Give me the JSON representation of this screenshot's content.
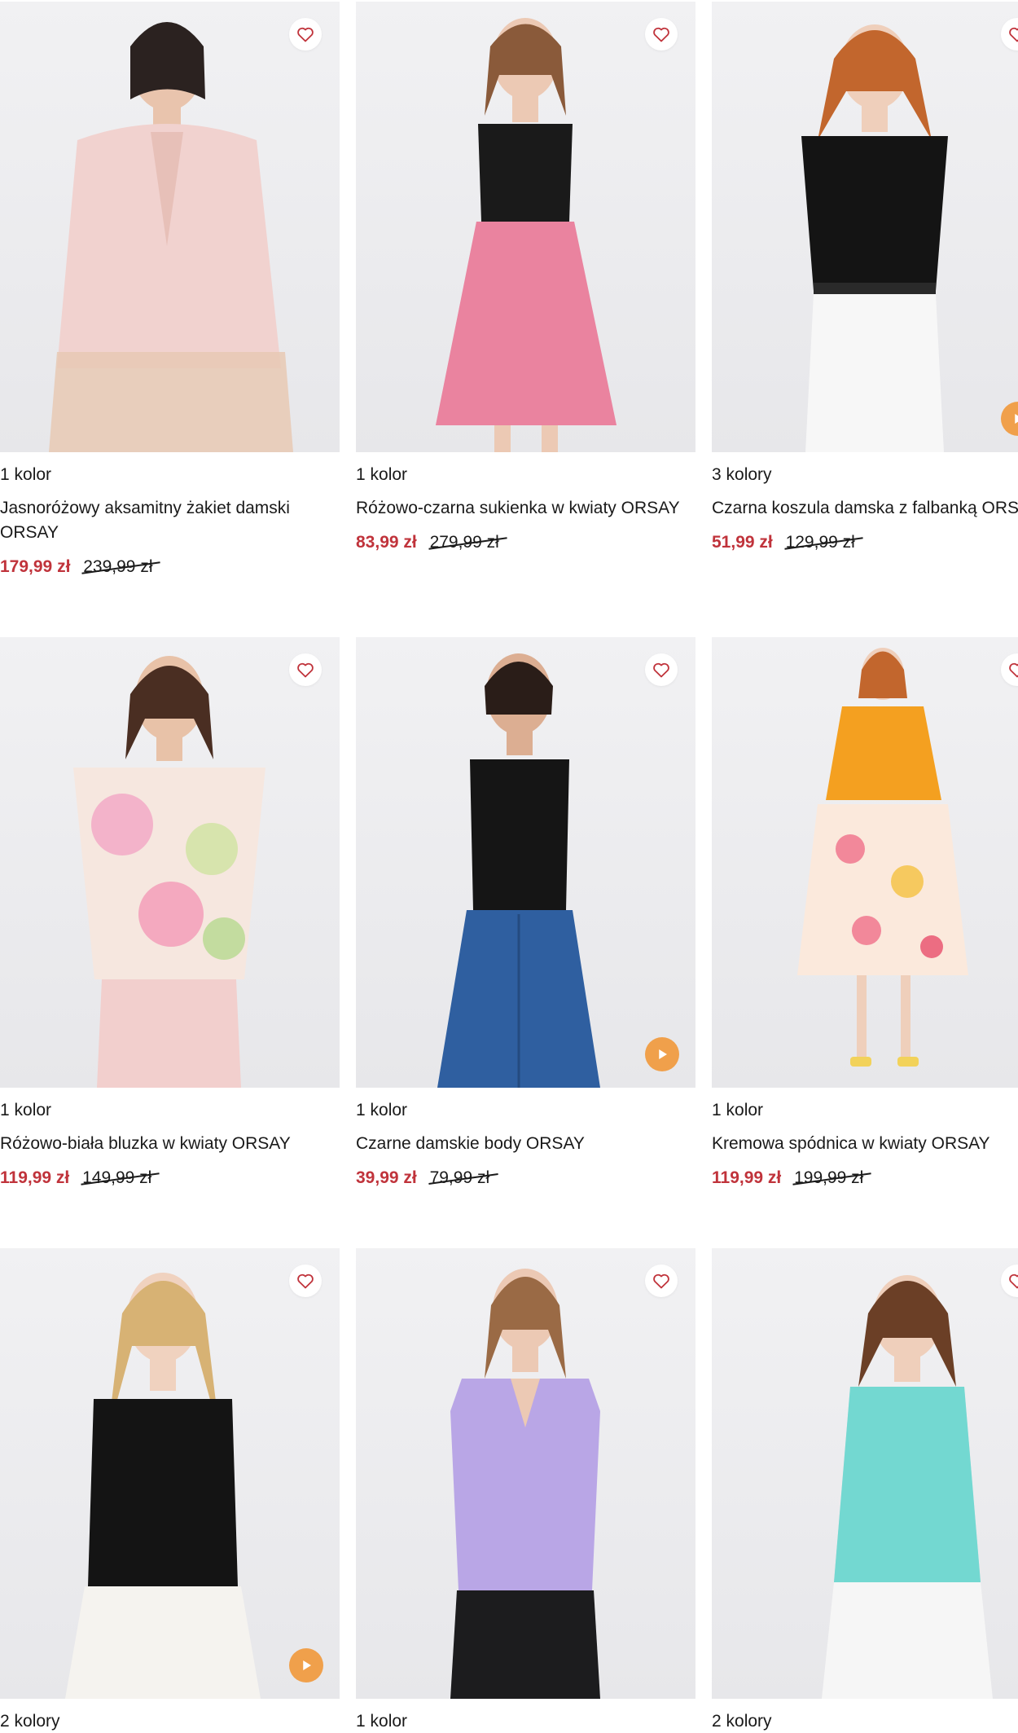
{
  "colors": {
    "accent_price": "#c0333b",
    "play_button": "#f0a04b",
    "heart_icon": "#c0333b"
  },
  "icons": {
    "favorite": "heart-outline-icon",
    "video": "play-icon"
  },
  "products": [
    {
      "colors_count": "1 kolor",
      "name": "Jasnoróżowy aksamitny żakiet damski ORSAY",
      "price": "179,99 zł",
      "old_price": "239,99 zł",
      "has_video": false
    },
    {
      "colors_count": "1 kolor",
      "name": "Różowo-czarna sukienka w kwiaty ORSAY",
      "price": "83,99 zł",
      "old_price": "279,99 zł",
      "has_video": false
    },
    {
      "colors_count": "3 kolory",
      "name": "Czarna koszula damska z falbanką ORSAY",
      "price": "51,99 zł",
      "old_price": "129,99 zł",
      "has_video": true
    },
    {
      "colors_count": "1 kolor",
      "name": "Różowo-biała bluzka w kwiaty ORSAY",
      "price": "119,99 zł",
      "old_price": "149,99 zł",
      "has_video": false
    },
    {
      "colors_count": "1 kolor",
      "name": "Czarne damskie body ORSAY",
      "price": "39,99 zł",
      "old_price": "79,99 zł",
      "has_video": true
    },
    {
      "colors_count": "1 kolor",
      "name": "Kremowa spódnica w kwiaty ORSAY",
      "price": "119,99 zł",
      "old_price": "199,99 zł",
      "has_video": false
    },
    {
      "colors_count": "2 kolory",
      "has_video": true
    },
    {
      "colors_count": "1 kolor",
      "has_video": false
    },
    {
      "colors_count": "2 kolory",
      "has_video": false
    }
  ]
}
